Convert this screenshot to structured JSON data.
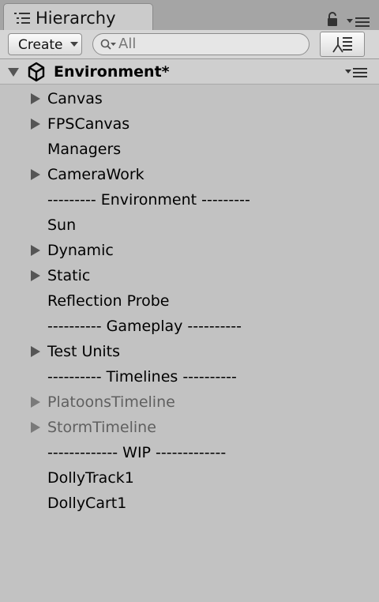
{
  "window": {
    "tab_title": "Hierarchy"
  },
  "toolbar": {
    "create_label": "Create",
    "search_placeholder": "All"
  },
  "scene": {
    "name": "Environment*"
  },
  "hierarchy": {
    "items": [
      {
        "label": "Canvas",
        "expandable": true,
        "inactive": false
      },
      {
        "label": "FPSCanvas",
        "expandable": true,
        "inactive": false
      },
      {
        "label": "Managers",
        "expandable": false,
        "inactive": false
      },
      {
        "label": "CameraWork",
        "expandable": true,
        "inactive": false
      },
      {
        "label": "--------- Environment ---------",
        "expandable": false,
        "inactive": false
      },
      {
        "label": "Sun",
        "expandable": false,
        "inactive": false
      },
      {
        "label": "Dynamic",
        "expandable": true,
        "inactive": false
      },
      {
        "label": "Static",
        "expandable": true,
        "inactive": false
      },
      {
        "label": "Reflection Probe",
        "expandable": false,
        "inactive": false
      },
      {
        "label": "---------- Gameplay ----------",
        "expandable": false,
        "inactive": false
      },
      {
        "label": "Test Units",
        "expandable": true,
        "inactive": false
      },
      {
        "label": "---------- Timelines ----------",
        "expandable": false,
        "inactive": false
      },
      {
        "label": "PlatoonsTimeline",
        "expandable": true,
        "inactive": true
      },
      {
        "label": "StormTimeline",
        "expandable": true,
        "inactive": true
      },
      {
        "label": "------------- WIP -------------",
        "expandable": false,
        "inactive": false
      },
      {
        "label": "DollyTrack1",
        "expandable": false,
        "inactive": false
      },
      {
        "label": "DollyCart1",
        "expandable": false,
        "inactive": false
      }
    ]
  }
}
